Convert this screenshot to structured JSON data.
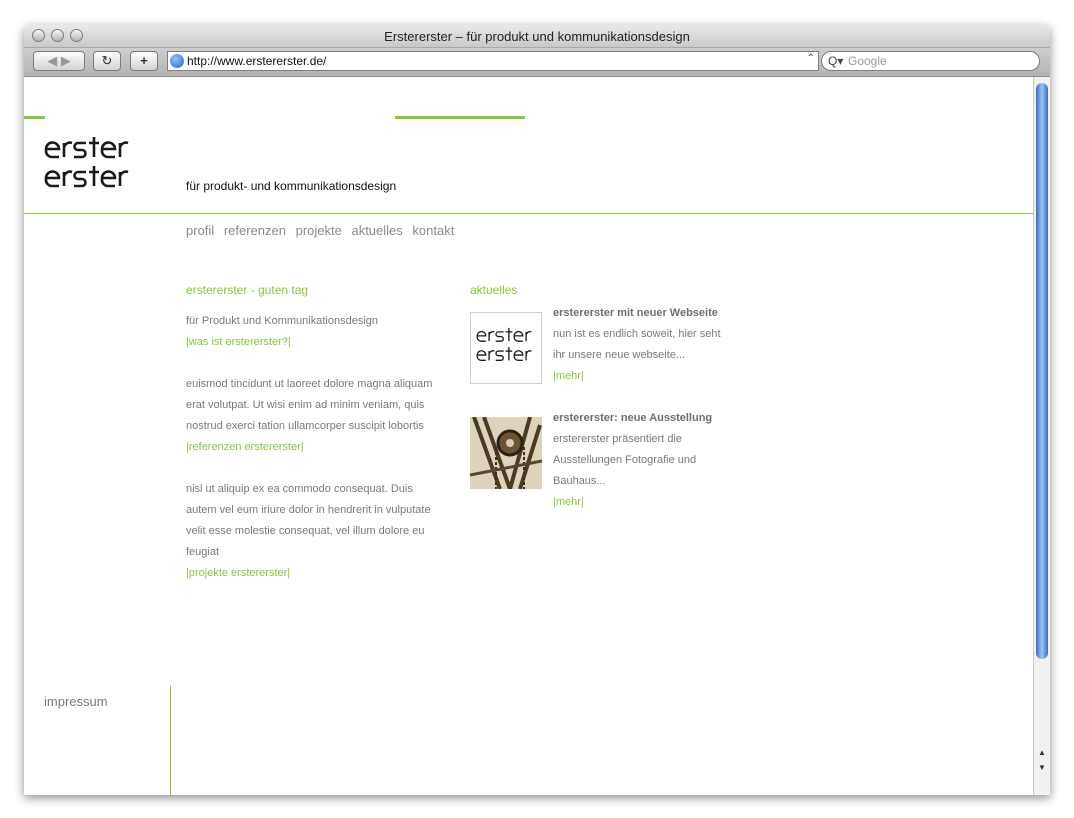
{
  "window": {
    "title": "Erstererster – für produkt und kommunikationsdesign",
    "url": "http://www.erstererster.de/",
    "search_placeholder": "Google"
  },
  "site": {
    "tagline": "für produkt- und kommunikationsdesign",
    "nav": [
      "profil",
      "referenzen",
      "projekte",
      "aktuelles",
      "kontakt"
    ],
    "intro": {
      "heading": "erstererster - guten tag",
      "subtitle": "für Produkt und Kommunikationsdesign",
      "link1": "|was ist erstererster?|",
      "para1": "euismod tincidunt ut laoreet dolore magna aliquam erat volutpat. Ut wisi enim ad minim veniam, quis nostrud exerci tation ullamcorper suscipit lobortis",
      "link2": "|referenzen erstererster|",
      "para2": "nisl ut aliquip ex ea commodo consequat. Duis autem vel eum iriure dolor in hendrerit in vulputate velit esse molestie consequat, vel illum dolore eu feugiat",
      "link3": "|projekte erstererster|"
    },
    "news": {
      "heading": "aktuelles",
      "items": [
        {
          "title": "erstererster mit neuer Webseite",
          "text": "nun ist es endlich soweit, hier seht ihr unsere neue webseite...",
          "more": "|mehr|"
        },
        {
          "title": "erstererster: neue Ausstellung",
          "text": "erstererster präsentiert die Ausstellungen Fotografie und Bauhaus...",
          "more": "|mehr|"
        }
      ]
    },
    "footer": {
      "impressum": "impressum"
    },
    "colors": {
      "accent": "#8ac53f",
      "text": "#7a7a7a"
    }
  }
}
